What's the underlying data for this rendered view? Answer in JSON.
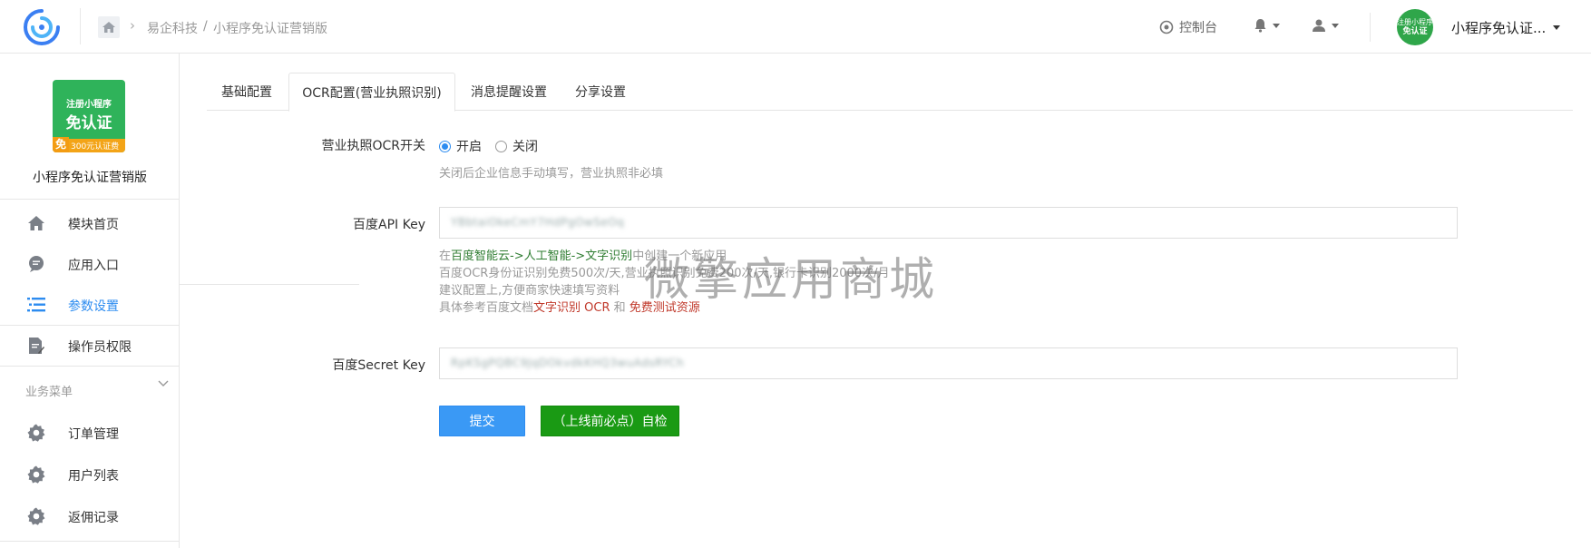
{
  "header": {
    "breadcrumb": [
      "易企科技",
      "小程序免认证营销版"
    ],
    "breadcrumb_sep": "/",
    "console_label": "控制台",
    "avatar_text": [
      "注册小程序",
      "免认证"
    ],
    "user_name": "小程序免认证..."
  },
  "sidebar": {
    "app_logo": {
      "line1": "注册小程序",
      "line2": "免认证",
      "badge": "免",
      "strip": "300元认证费"
    },
    "app_name": "小程序免认证营销版",
    "items": [
      {
        "label": "模块首页",
        "icon": "home-icon"
      },
      {
        "label": "应用入口",
        "icon": "chat-icon"
      },
      {
        "label": "参数设置",
        "icon": "list-icon",
        "active": true
      },
      {
        "label": "操作员权限",
        "icon": "document-edit-icon"
      }
    ],
    "group_title": "业务菜单",
    "group_items": [
      {
        "label": "订单管理",
        "icon": "gear-icon"
      },
      {
        "label": "用户列表",
        "icon": "gear-icon"
      },
      {
        "label": "返佣记录",
        "icon": "gear-icon"
      }
    ]
  },
  "tabs": [
    "基础配置",
    "OCR配置(营业执照识别)",
    "消息提醒设置",
    "分享设置"
  ],
  "form": {
    "ocr_switch": {
      "label": "营业执照OCR开关",
      "options": [
        "开启",
        "关闭"
      ],
      "selected": "开启",
      "hint": "关闭后企业信息手动填写，营业执照非必填"
    },
    "api_key": {
      "label": "百度API Key",
      "value": "YBbtaiOkeCmY7HdPgOwSeOq",
      "help": {
        "prefix": "在",
        "link1": "百度智能云->人工智能->文字识别",
        "suffix1": "中创建一个新应用",
        "line2": "百度OCR身份证识别免费500次/天,营业执照识别免费200次/天,银行卡识别2000次/月",
        "line3": "建议配置上,方便商家快速填写资料",
        "line4_prefix": "具体参考百度文档",
        "link2": "文字识别 OCR",
        "line4_mid": " 和 ",
        "link3": "免费测试资源"
      }
    },
    "secret_key": {
      "label": "百度Secret Key",
      "value": "RpKSgPQBC9JqDOkvdkKHQ3wuAdsRYCh"
    },
    "submit_label": "提交",
    "check_label": "（上线前必点）自检"
  },
  "watermark": "微擎应用商城",
  "colors": {
    "accent": "#2d8cf0",
    "submit": "#3a99f5",
    "check": "#1a9a14",
    "link_green": "#2f7d32",
    "link_red": "#c0392b"
  }
}
